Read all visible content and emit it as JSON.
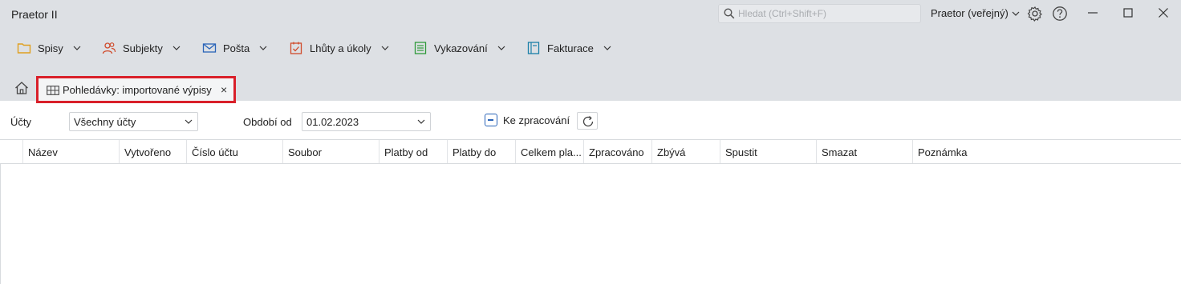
{
  "app": {
    "title": "Praetor II"
  },
  "search": {
    "placeholder": "Hledat (Ctrl+Shift+F)"
  },
  "profile": {
    "label": "Praetor (veřejný)"
  },
  "menu": {
    "items": [
      {
        "label": "Spisy",
        "icon": "folder-icon",
        "color": "#e0a020"
      },
      {
        "label": "Subjekty",
        "icon": "users-icon",
        "color": "#d04a2a"
      },
      {
        "label": "Pošta",
        "icon": "mail-icon",
        "color": "#2a64b8"
      },
      {
        "label": "Lhůty a úkoly",
        "icon": "calendar-check-icon",
        "color": "#d04a2a"
      },
      {
        "label": "Vykazování",
        "icon": "list-sheet-icon",
        "color": "#2f9a3a"
      },
      {
        "label": "Fakturace",
        "icon": "invoice-icon",
        "color": "#1a7fa8"
      }
    ]
  },
  "tab": {
    "label": "Pohledávky: importované výpisy",
    "close": "×"
  },
  "filters": {
    "accounts_label": "Účty",
    "accounts_value": "Všechny účty",
    "period_label": "Období od",
    "period_value": "01.02.2023",
    "pending_label": "Ke zpracování"
  },
  "table": {
    "columns": [
      "Název",
      "Vytvořeno",
      "Číslo účtu",
      "Soubor",
      "Platby od",
      "Platby do",
      "Celkem pla...",
      "Zpracováno",
      "Zbývá",
      "Spustit",
      "Smazat",
      "Poznámka"
    ],
    "rows": []
  },
  "colors": {
    "accent": "#2a64b8",
    "highlight": "#d9202a",
    "topbar": "#dde0e4"
  }
}
